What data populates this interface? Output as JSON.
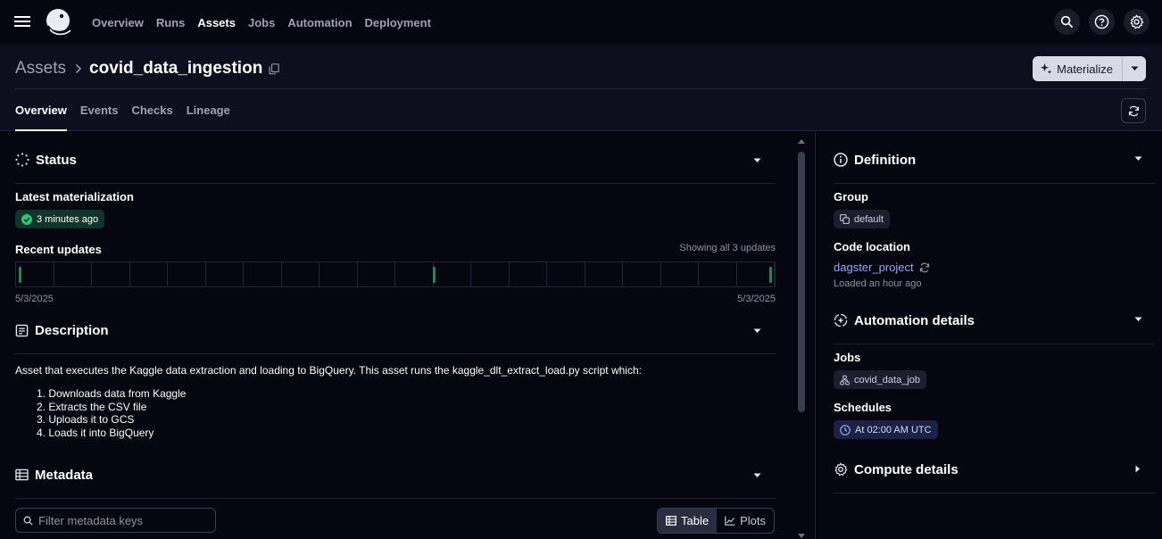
{
  "nav": {
    "links": [
      "Overview",
      "Runs",
      "Assets",
      "Jobs",
      "Automation",
      "Deployment"
    ],
    "active": "Assets"
  },
  "header": {
    "breadcrumb_root": "Assets",
    "asset_name": "covid_data_ingestion",
    "materialize_label": "Materialize",
    "tabs": [
      "Overview",
      "Events",
      "Checks",
      "Lineage"
    ],
    "active_tab": "Overview"
  },
  "status": {
    "title": "Status",
    "latest_label": "Latest materialization",
    "latest_value": "3 minutes ago",
    "recent_label": "Recent updates",
    "showing_text": "Showing all 3 updates",
    "date_start": "5/3/2025",
    "date_end": "5/3/2025",
    "timeline_cells": 20,
    "update_marks": [
      0.005,
      0.55,
      0.995
    ]
  },
  "description": {
    "title": "Description",
    "text": "Asset that executes the Kaggle data extraction and loading to BigQuery. This asset runs the kaggle_dlt_extract_load.py script which:",
    "steps": [
      "1. Downloads data from Kaggle",
      "2. Extracts the CSV file",
      "3. Uploads it to GCS",
      "4. Loads it into BigQuery"
    ]
  },
  "metadata": {
    "title": "Metadata",
    "filter_placeholder": "Filter metadata keys",
    "view_table": "Table",
    "view_plots": "Plots"
  },
  "definition": {
    "title": "Definition",
    "group_label": "Group",
    "group_value": "default",
    "code_location_label": "Code location",
    "code_location_value": "dagster_project",
    "loaded_text": "Loaded an hour ago"
  },
  "automation": {
    "title": "Automation details",
    "jobs_label": "Jobs",
    "job_value": "covid_data_job",
    "schedules_label": "Schedules",
    "schedule_value": "At 02:00 AM UTC"
  },
  "compute": {
    "title": "Compute details"
  },
  "colors": {
    "background": "#05060f",
    "header": "#0d0f1e",
    "success": "#1f8a57",
    "link": "#9aa6f2"
  }
}
